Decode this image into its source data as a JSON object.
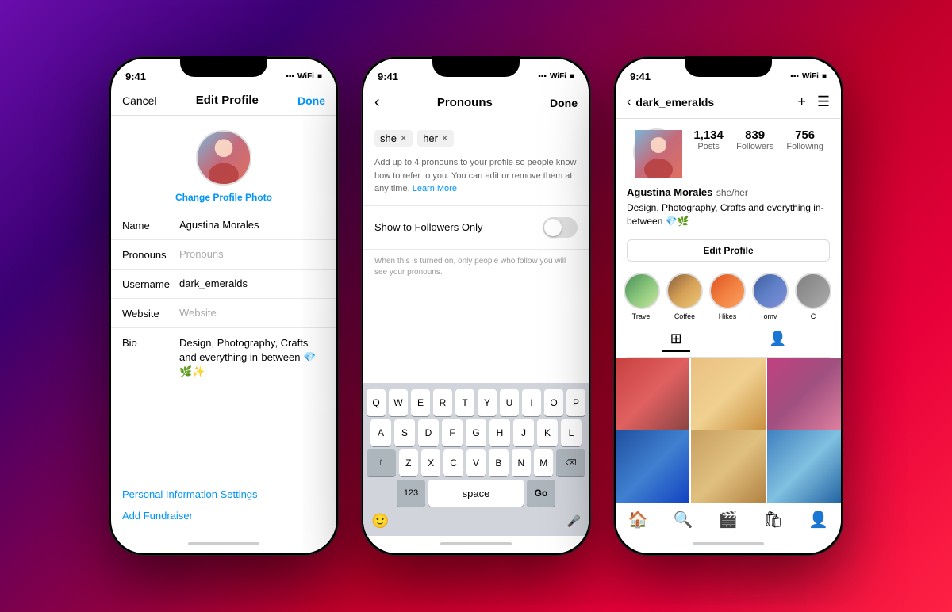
{
  "background": {
    "gradient": "linear-gradient(135deg, #6a0dad, #c0002a, #ff2244)"
  },
  "phone1": {
    "status_time": "9:41",
    "nav_cancel": "Cancel",
    "nav_title": "Edit Profile",
    "nav_done": "Done",
    "change_photo": "Change Profile Photo",
    "fields": [
      {
        "label": "Name",
        "value": "Agustina Morales",
        "placeholder": ""
      },
      {
        "label": "Pronouns",
        "value": "",
        "placeholder": "Pronouns"
      },
      {
        "label": "Username",
        "value": "dark_emeralds",
        "placeholder": ""
      },
      {
        "label": "Website",
        "value": "",
        "placeholder": "Website"
      },
      {
        "label": "Bio",
        "value": "Design, Photography, Crafts and everything in-between 💎🌿✨",
        "placeholder": ""
      }
    ],
    "links": [
      "Personal Information Settings",
      "Add Fundraiser"
    ]
  },
  "phone2": {
    "status_time": "9:41",
    "nav_title": "Pronouns",
    "nav_done": "Done",
    "tags": [
      "she",
      "her"
    ],
    "description": "Add up to 4 pronouns to your profile so people know how to refer to you. You can edit or remove them at any time.",
    "learn_more": "Learn More",
    "toggle_label": "Show to Followers Only",
    "toggle_hint": "When this is turned on, only people who follow you will see your pronouns.",
    "keyboard": {
      "row1": [
        "Q",
        "W",
        "E",
        "R",
        "T",
        "Y",
        "U",
        "I",
        "O",
        "P"
      ],
      "row2": [
        "A",
        "S",
        "D",
        "F",
        "G",
        "H",
        "J",
        "K",
        "L"
      ],
      "row3": [
        "Z",
        "X",
        "C",
        "V",
        "B",
        "N",
        "M"
      ],
      "space": "space",
      "go": "Go",
      "num": "123"
    }
  },
  "phone3": {
    "status_time": "9:41",
    "username": "dark_emeralds",
    "nav_plus": "+",
    "nav_menu": "≡",
    "stats": [
      {
        "number": "1,134",
        "label": "Posts"
      },
      {
        "number": "839",
        "label": "Followers"
      },
      {
        "number": "756",
        "label": "Following"
      }
    ],
    "bio_name": "Agustina Morales",
    "bio_pronouns": "she/her",
    "bio_text": "Design, Photography, Crafts and everything in-between 💎🌿",
    "edit_profile_btn": "Edit Profile",
    "highlights": [
      {
        "label": "Travel",
        "class": "hl-travel"
      },
      {
        "label": "Coffee",
        "class": "hl-coffee"
      },
      {
        "label": "Hikes",
        "class": "hl-hikes"
      },
      {
        "label": "omv",
        "class": "hl-omv"
      },
      {
        "label": "C",
        "class": "hl-extra"
      }
    ]
  }
}
